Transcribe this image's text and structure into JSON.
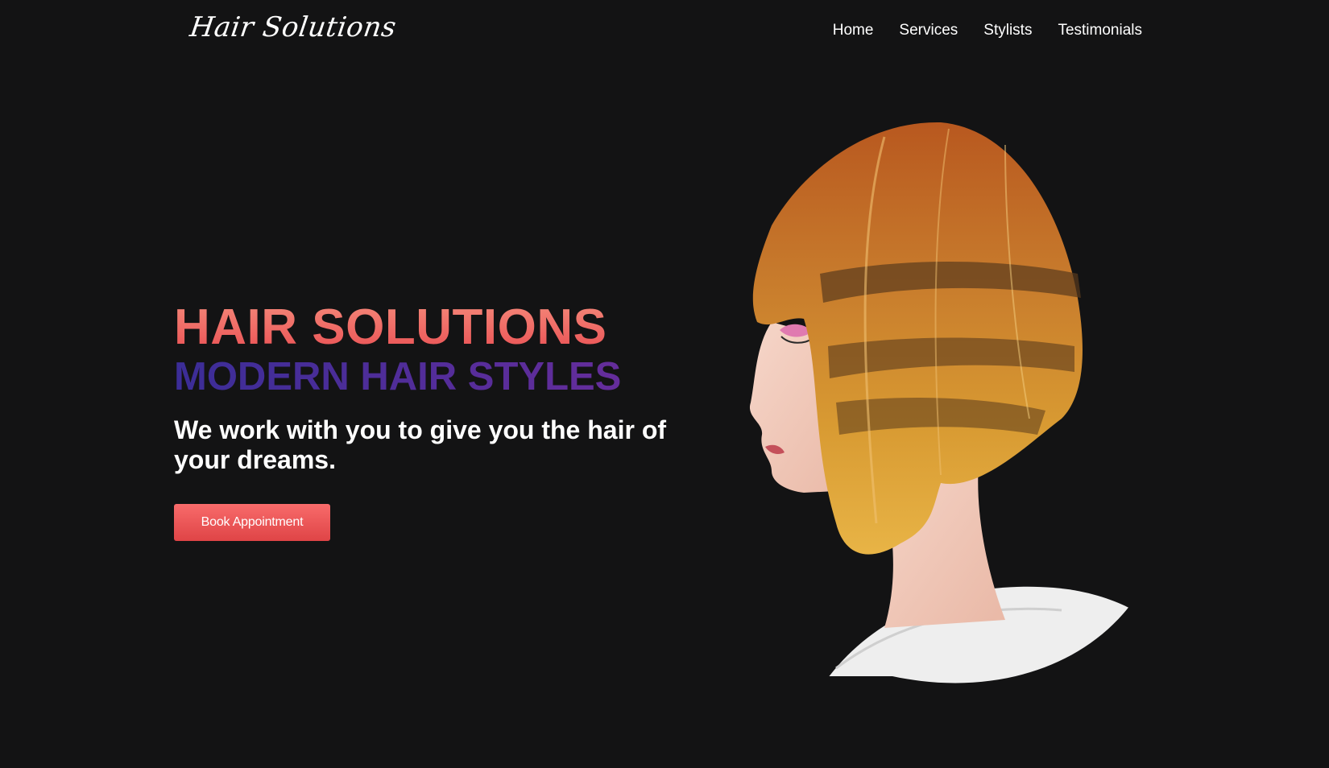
{
  "header": {
    "logo_text": "Hair Solutions",
    "nav": [
      "Home",
      "Services",
      "Stylists",
      "Testimonials"
    ]
  },
  "hero": {
    "title": "HAIR SOLUTIONS",
    "subtitle": "MODERN HAIR STYLES",
    "text": "We work with you to give you the hair of your dreams.",
    "cta_label": "Book Appointment"
  },
  "colors": {
    "background": "#131314",
    "title_gradient": [
      "#f58a7b",
      "#e94e52"
    ],
    "subtitle_gradient": [
      "#3b2d97",
      "#6c2d9c"
    ],
    "button": "#e94e52"
  },
  "image": {
    "icon": "portrait-image"
  }
}
